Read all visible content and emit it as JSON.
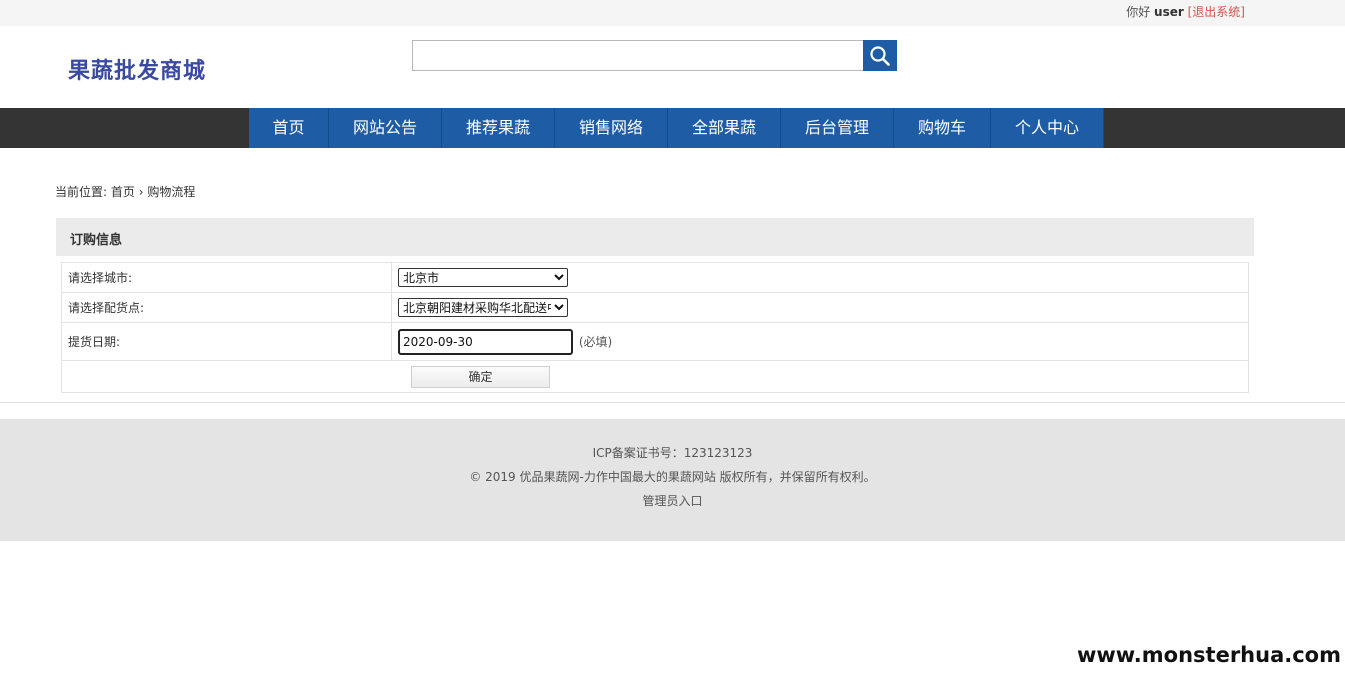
{
  "topbar": {
    "greeting": "你好",
    "username": "user",
    "logout": "[退出系统]"
  },
  "header": {
    "logo": "果蔬批发商城",
    "search_placeholder": "",
    "search_icon": "search-icon"
  },
  "nav": {
    "items": [
      {
        "label": "首页"
      },
      {
        "label": "网站公告"
      },
      {
        "label": "推荐果蔬"
      },
      {
        "label": "销售网络"
      },
      {
        "label": "全部果蔬"
      },
      {
        "label": "后台管理"
      },
      {
        "label": "购物车"
      },
      {
        "label": "个人中心"
      }
    ]
  },
  "breadcrumb": {
    "prefix": "当前位置:",
    "home": "首页",
    "separator": "›",
    "current": "购物流程"
  },
  "panel": {
    "title": "订购信息"
  },
  "form": {
    "city_label": "请选择城市:",
    "city_value": "北京市",
    "store_label": "请选择配货点:",
    "store_value": "北京朝阳建材采购华北配送中心",
    "date_label": "提货日期:",
    "date_value": "2020-09-30",
    "date_hint": "(必填)",
    "submit": "确定"
  },
  "footer": {
    "icp": "ICP备案证书号：123123123",
    "copyright": "© 2019 优品果蔬网-力作中国最大的果蔬网站 版权所有，并保留所有权利。",
    "admin": "管理员入口"
  },
  "watermark": "www.monsterhua.com",
  "colors": {
    "nav_bg": "#1e5da6",
    "nav_bar": "#343434",
    "logo": "#3a4aa0",
    "logout": "#d9534f"
  }
}
